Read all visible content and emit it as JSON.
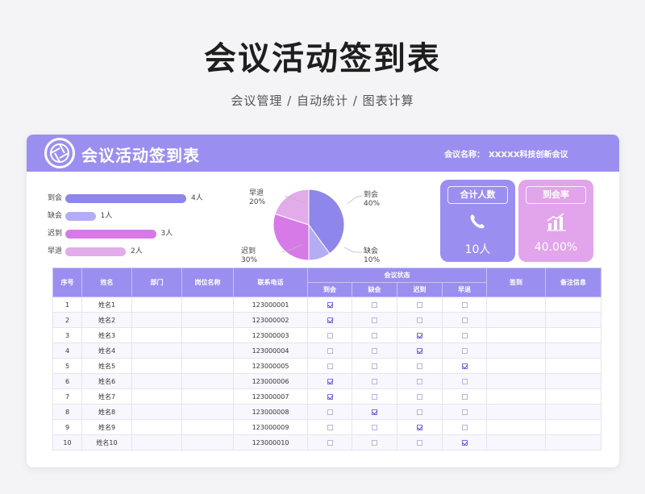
{
  "page": {
    "title": "会议活动签到表",
    "subtitle": "会议管理 / 自动统计 / 图表计算"
  },
  "header": {
    "title": "会议活动签到表",
    "meeting_label": "会议名称：",
    "meeting_name": "XXXXX科技创新会议"
  },
  "colors": {
    "primary": "#9a8ff0",
    "ontime": "#8e86ea",
    "absent": "#b4acf4",
    "late": "#d57ae6",
    "early": "#e2abe9",
    "stat_total": "#9a8ff0",
    "stat_rate": "#e2a4ea"
  },
  "chart_data": {
    "type": "bar",
    "categories": [
      "到会",
      "缺会",
      "迟到",
      "早退"
    ],
    "values": [
      4,
      1,
      3,
      2
    ],
    "value_labels": [
      "4人",
      "1人",
      "3人",
      "2人"
    ],
    "xlim": [
      0,
      4
    ]
  },
  "pie_data": {
    "type": "pie",
    "slices": [
      {
        "name": "到会",
        "value": 40,
        "label": "40%"
      },
      {
        "name": "缺会",
        "value": 10,
        "label": "10%"
      },
      {
        "name": "迟到",
        "value": 30,
        "label": "30%"
      },
      {
        "name": "早退",
        "value": 20,
        "label": "20%"
      }
    ]
  },
  "stats": {
    "total_title": "合计人数",
    "total_value": "10人",
    "total_icon": "phone-icon",
    "rate_title": "到会率",
    "rate_value": "40.00%",
    "rate_icon": "bar-chart-icon"
  },
  "table": {
    "headers": {
      "no": "序号",
      "name": "姓名",
      "dept": "部门",
      "position": "岗位名称",
      "phone": "联系电话",
      "status_group": "会议状态",
      "ontime": "到会",
      "absent": "缺会",
      "late": "迟到",
      "early": "早退",
      "sign": "签到",
      "note": "备注信息"
    },
    "rows": [
      {
        "no": "1",
        "name": "姓名1",
        "phone": "123000001",
        "status": "ontime"
      },
      {
        "no": "2",
        "name": "姓名2",
        "phone": "123000002",
        "status": "ontime"
      },
      {
        "no": "3",
        "name": "姓名3",
        "phone": "123000003",
        "status": "late"
      },
      {
        "no": "4",
        "name": "姓名4",
        "phone": "123000004",
        "status": "late"
      },
      {
        "no": "5",
        "name": "姓名5",
        "phone": "123000005",
        "status": "early"
      },
      {
        "no": "6",
        "name": "姓名6",
        "phone": "123000006",
        "status": "ontime"
      },
      {
        "no": "7",
        "name": "姓名7",
        "phone": "123000007",
        "status": "ontime"
      },
      {
        "no": "8",
        "name": "姓名8",
        "phone": "123000008",
        "status": "absent"
      },
      {
        "no": "9",
        "name": "姓名9",
        "phone": "123000009",
        "status": "late"
      },
      {
        "no": "10",
        "name": "姓名10",
        "phone": "123000010",
        "status": "early"
      }
    ]
  }
}
